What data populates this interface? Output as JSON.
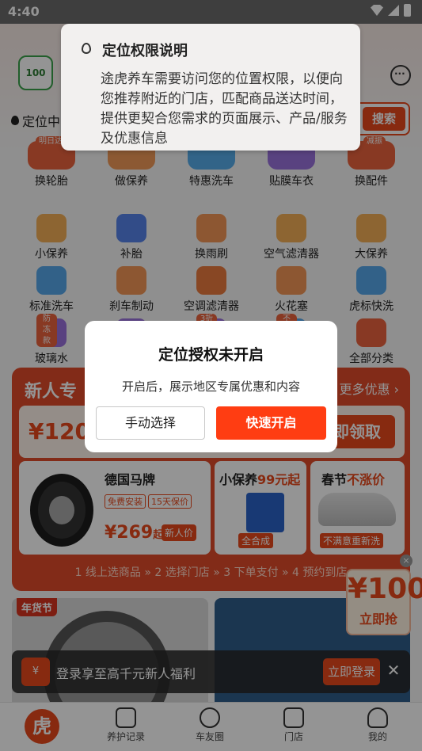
{
  "status_bar": {
    "time": "4:40"
  },
  "header": {
    "logo_text": "100",
    "location_text": "定位中",
    "search_button": "搜索"
  },
  "categories": [
    {
      "label": "换轮胎",
      "badge": "明日达",
      "color": "#e8491d"
    },
    {
      "label": "做保养",
      "badge": "",
      "color": "#f08a3c"
    },
    {
      "label": "特惠洗车",
      "badge": "",
      "color": "#3aa0e8"
    },
    {
      "label": "贴膜车衣",
      "badge": "",
      "color": "#8a5ad8"
    },
    {
      "label": "换配件",
      "badge": "减振",
      "color": "#e8491d"
    },
    {
      "label": "小保养",
      "badge": "",
      "color": "#f2a23a"
    },
    {
      "label": "补胎",
      "badge": "",
      "color": "#3a6ee8"
    },
    {
      "label": "换雨刷",
      "badge": "",
      "color": "#f2853a"
    },
    {
      "label": "空气滤清器",
      "badge": "",
      "color": "#f2a23a"
    },
    {
      "label": "大保养",
      "badge": "",
      "color": "#f2a23a"
    },
    {
      "label": "标准洗车",
      "badge": "",
      "color": "#3a9ae8"
    },
    {
      "label": "刹车制动",
      "badge": "",
      "color": "#f2853a"
    },
    {
      "label": "空调滤清器",
      "badge": "",
      "color": "#e8641d"
    },
    {
      "label": "火花塞",
      "badge": "",
      "color": "#f2853a"
    },
    {
      "label": "虎标快洗",
      "badge": "",
      "color": "#3a9ae8"
    },
    {
      "label": "玻璃水",
      "badge": "防冻款",
      "color": "#8a5ad8"
    },
    {
      "label": "",
      "badge": "",
      "color": "#8a5ad8"
    },
    {
      "label": "",
      "badge": "3折抢",
      "color": "#8a5ad8"
    },
    {
      "label": "",
      "badge": "不涨价",
      "color": "#3a9ae8"
    },
    {
      "label": "全部分类",
      "badge": "",
      "color": "#e8491d"
    }
  ],
  "promo": {
    "title": "新人专",
    "more": "更多优惠 ›",
    "coupon_amount": "¥1200",
    "coupon_button": "即领取",
    "card1": {
      "title": "德国马牌",
      "tags": [
        "免费安装",
        "15天保价"
      ],
      "price": "¥269",
      "price_suffix": "起",
      "new_tag": "新人价"
    },
    "card2": {
      "title_a": "小保养",
      "title_b": "99元起",
      "sub": "全合成"
    },
    "card3": {
      "title_a": "春节",
      "title_b": "不涨价",
      "sub": "不满意重新洗"
    },
    "steps": "1 线上选商品  »  2 选择门店  »  3 下单支付  »  4 预约到店"
  },
  "float_coupon": {
    "amount": "¥100",
    "action": "立即抢"
  },
  "banner": {
    "tag": "年货节"
  },
  "login_bar": {
    "icon_text": "¥",
    "text": "登录享至高千元新人福利",
    "button": "立即登录",
    "close": "✕"
  },
  "tabbar": [
    {
      "label": "",
      "icon": "虎"
    },
    {
      "label": "养护记录",
      "icon": ""
    },
    {
      "label": "车友圈",
      "icon": ""
    },
    {
      "label": "门店",
      "icon": ""
    },
    {
      "label": "我的",
      "icon": ""
    }
  ],
  "permission_popup": {
    "title": "定位权限说明",
    "body": "途虎养车需要访问您的位置权限，以便向您推荐附近的门店，匹配商品送达时间，提供更契合您需求的页面展示、产品/服务及优惠信息"
  },
  "dialog": {
    "title": "定位授权未开启",
    "message": "开启后，展示地区专属优惠和内容",
    "manual_button": "手动选择",
    "fast_button": "快速开启"
  },
  "colors": {
    "accent": "#e8491d",
    "primary_button": "#ff3d12",
    "overlay": "rgba(0,0,0,0.42)"
  }
}
